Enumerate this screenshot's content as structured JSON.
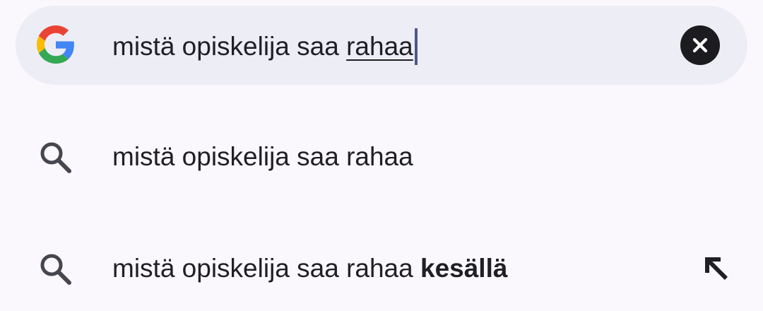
{
  "search": {
    "query_prefix": "mistä opiskelija saa ",
    "query_underlined": "rahaa",
    "logo_icon": "google-g-icon",
    "clear_icon": "close-icon",
    "colors": {
      "bar_bg": "#ededf6",
      "cursor": "#4f5790",
      "clear_bg": "#1c1b20",
      "g_blue": "#4285F4",
      "g_red": "#EA4335",
      "g_yellow": "#FBBC05",
      "g_green": "#34A853"
    }
  },
  "suggestions": [
    {
      "text": "mistä opiskelija saa rahaa",
      "bold_suffix": "",
      "icon": "search-icon",
      "has_fill_arrow": false
    },
    {
      "text": "mistä opiskelija saa rahaa ",
      "bold_suffix": "kesällä",
      "icon": "search-icon",
      "has_fill_arrow": true,
      "fill_icon": "arrow-up-left-icon"
    }
  ]
}
